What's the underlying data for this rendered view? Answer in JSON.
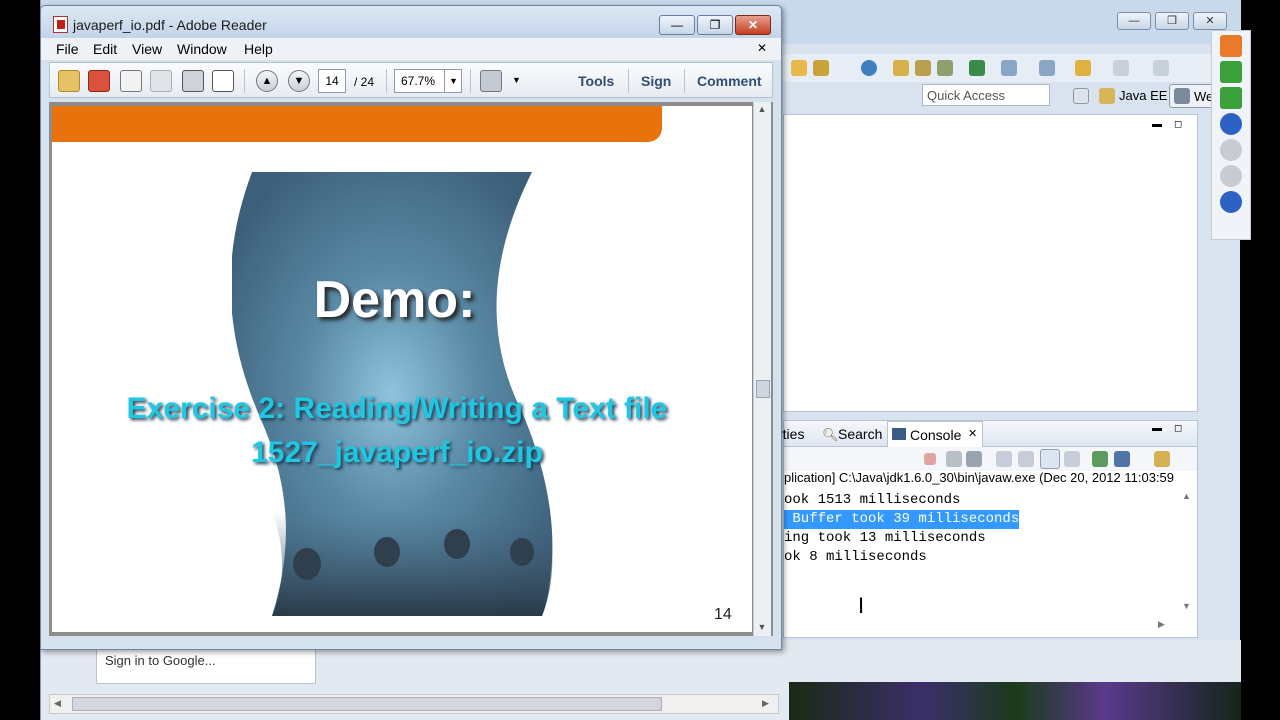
{
  "eclipse": {
    "quick_access_placeholder": "Quick Access",
    "perspective_java_ee": "Java EE",
    "perspective_web": "We",
    "tabs": {
      "properties": "rties",
      "search": "Search",
      "console": "Console"
    },
    "console_header": "plication] C:\\Java\\jdk1.6.0_30\\bin\\javaw.exe (Dec 20, 2012 11:03:59",
    "console_lines": [
      "ook 1513 milliseconds",
      " Buffer took 39 milliseconds",
      "ing took 13 milliseconds",
      "ok 8 milliseconds"
    ],
    "sign_in_text": "Sign in to Google..."
  },
  "reader": {
    "title": "javaperf_io.pdf - Adobe Reader",
    "menu": [
      "File",
      "Edit",
      "View",
      "Window",
      "Help"
    ],
    "page_current": "14",
    "page_total": "/ 24",
    "zoom": "67.7%",
    "tools_label": "Tools",
    "sign_label": "Sign",
    "comment_label": "Comment"
  },
  "slide": {
    "heading": "Demo:",
    "line1": "Exercise 2: Reading/Writing a Text file",
    "line2": "1527_javaperf_io.zip",
    "page_number": "14"
  },
  "colors": {
    "accent_orange": "#e8720c",
    "exercise_text": "#1fc8e0",
    "console_highlight": "#3399ff"
  }
}
